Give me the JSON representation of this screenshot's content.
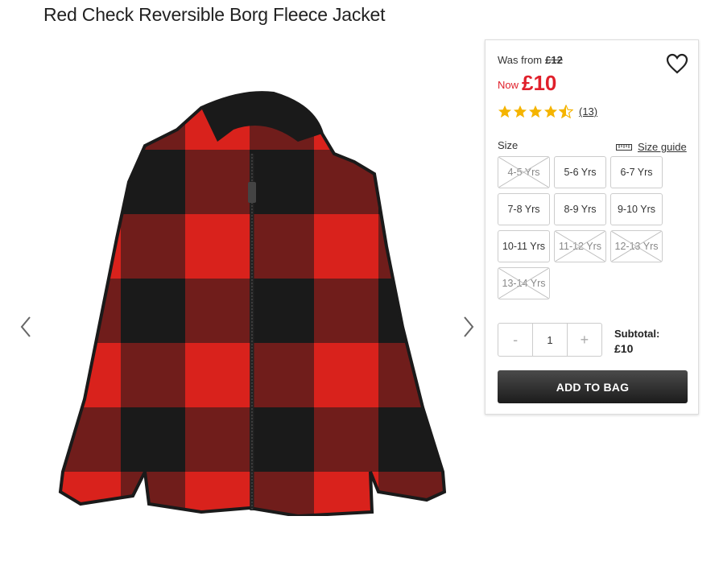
{
  "product": {
    "title": "Red Check Reversible Borg Fleece Jacket",
    "image_alt": "Red and black check borg fleece jacket"
  },
  "pricing": {
    "was_label": "Was from",
    "was_price": "£12",
    "now_label": "Now",
    "now_price": "£10"
  },
  "rating": {
    "stars": 4.5,
    "out_of": 5,
    "reviews_text": "(13)"
  },
  "size": {
    "label": "Size",
    "guide_label": "Size guide",
    "options": [
      {
        "label": "4-5 Yrs",
        "available": false
      },
      {
        "label": "5-6 Yrs",
        "available": true
      },
      {
        "label": "6-7 Yrs",
        "available": true
      },
      {
        "label": "7-8 Yrs",
        "available": true
      },
      {
        "label": "8-9 Yrs",
        "available": true
      },
      {
        "label": "9-10 Yrs",
        "available": true
      },
      {
        "label": "10-11 Yrs",
        "available": true
      },
      {
        "label": "11-12 Yrs",
        "available": false
      },
      {
        "label": "12-13 Yrs",
        "available": false
      },
      {
        "label": "13-14 Yrs",
        "available": false
      }
    ]
  },
  "quantity": {
    "minus": "-",
    "value": "1",
    "plus": "+"
  },
  "subtotal": {
    "label": "Subtotal:",
    "value": "£10"
  },
  "actions": {
    "add_to_bag": "ADD TO BAG"
  },
  "colors": {
    "price_red": "#e0202b",
    "star_gold": "#f5b400",
    "jacket_red": "#d9221c",
    "jacket_black": "#1a1a1a"
  },
  "icons": {
    "prev": "chevron-left-icon",
    "next": "chevron-right-icon",
    "wishlist": "heart-icon",
    "size_guide": "ruler-icon"
  }
}
